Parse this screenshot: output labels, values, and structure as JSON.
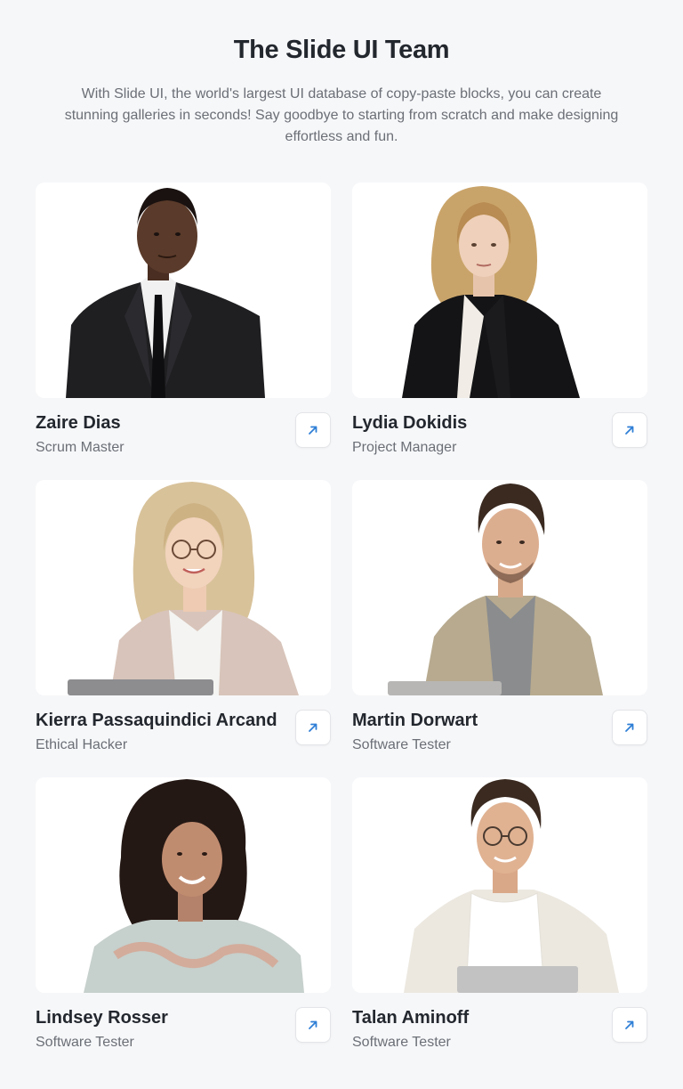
{
  "header": {
    "title": "The Slide UI Team",
    "subtitle": "With Slide UI, the world's largest UI database of copy-paste blocks, you can create stunning galleries in seconds! Say goodbye to starting from scratch and make designing effortless and fun."
  },
  "team": [
    {
      "name": "Zaire Dias",
      "role": "Scrum Master",
      "icon": "arrow-up-right-icon"
    },
    {
      "name": "Lydia Dokidis",
      "role": "Project Manager",
      "icon": "arrow-up-right-icon"
    },
    {
      "name": "Kierra Passaquindici Arcand",
      "role": "Ethical Hacker",
      "icon": "arrow-up-right-icon"
    },
    {
      "name": "Martin Dorwart",
      "role": "Software Tester",
      "icon": "arrow-up-right-icon"
    },
    {
      "name": "Lindsey Rosser",
      "role": "Software Tester",
      "icon": "arrow-up-right-icon"
    },
    {
      "name": "Talan Aminoff",
      "role": "Software Tester",
      "icon": "arrow-up-right-icon"
    }
  ],
  "colors": {
    "background": "#f6f7f9",
    "accent": "#2f7fd6",
    "heading": "#23272e",
    "muted": "#6b6f76"
  }
}
